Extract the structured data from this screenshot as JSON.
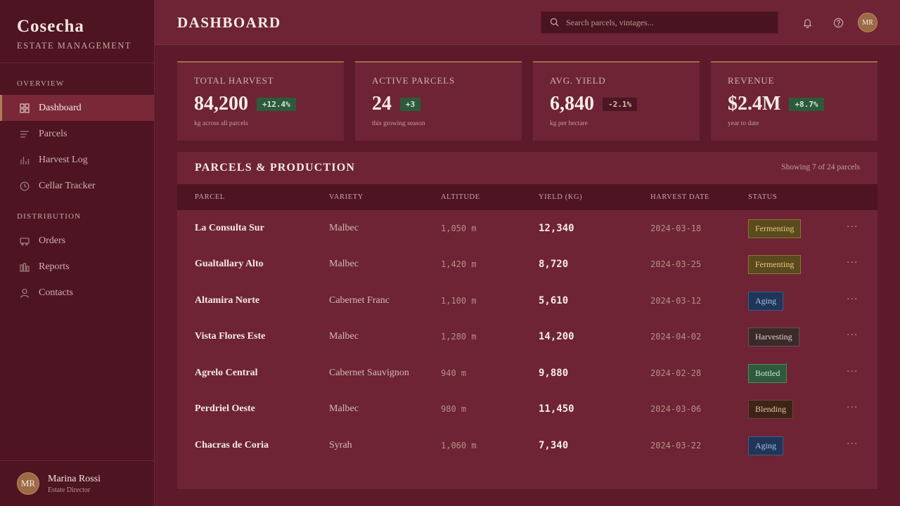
{
  "brand": {
    "name": "Cosecha",
    "subtitle": "ESTATE MANAGEMENT"
  },
  "sidebar": {
    "sections": [
      {
        "label": "OVERVIEW",
        "items": [
          {
            "label": "Dashboard",
            "icon": "grid-icon",
            "active": true
          },
          {
            "label": "Parcels",
            "icon": "list-icon"
          },
          {
            "label": "Harvest Log",
            "icon": "bar-chart-icon"
          },
          {
            "label": "Cellar Tracker",
            "icon": "clock-icon"
          }
        ]
      },
      {
        "label": "DISTRIBUTION",
        "items": [
          {
            "label": "Orders",
            "icon": "truck-icon"
          },
          {
            "label": "Reports",
            "icon": "reports-icon"
          },
          {
            "label": "Contacts",
            "icon": "user-icon"
          }
        ]
      }
    ]
  },
  "user": {
    "name": "Marina Rossi",
    "role": "Estate Director",
    "initials": "MR"
  },
  "header": {
    "title": "DASHBOARD",
    "search_placeholder": "Search parcels, vintages...",
    "avatar_initials": "MR"
  },
  "stats": [
    {
      "label": "TOTAL HARVEST",
      "value": "84,200",
      "change": "+12.4%",
      "trend": "up",
      "foot": "kg across all parcels"
    },
    {
      "label": "ACTIVE PARCELS",
      "value": "24",
      "change": "+3",
      "trend": "up",
      "foot": "this growing season"
    },
    {
      "label": "AVG. YIELD",
      "value": "6,840",
      "change": "-2.1%",
      "trend": "down",
      "foot": "kg per hectare"
    },
    {
      "label": "REVENUE",
      "value": "$2.4M",
      "change": "+8.7%",
      "trend": "up",
      "foot": "year to date"
    }
  ],
  "table": {
    "title": "PARCELS & PRODUCTION",
    "meta": "Showing 7 of 24 parcels",
    "columns": [
      "PARCEL",
      "VARIETY",
      "ALTITUDE",
      "YIELD (KG)",
      "HARVEST DATE",
      "STATUS"
    ],
    "rows": [
      {
        "parcel": "La Consulta Sur",
        "variety": "Malbec",
        "altitude": "1,050 m",
        "yield": "12,340",
        "date": "2024-03-18",
        "status": "Fermenting"
      },
      {
        "parcel": "Gualtallary Alto",
        "variety": "Malbec",
        "altitude": "1,420 m",
        "yield": "8,720",
        "date": "2024-03-25",
        "status": "Fermenting"
      },
      {
        "parcel": "Altamira Norte",
        "variety": "Cabernet Franc",
        "altitude": "1,100 m",
        "yield": "5,610",
        "date": "2024-03-12",
        "status": "Aging"
      },
      {
        "parcel": "Vista Flores Este",
        "variety": "Malbec",
        "altitude": "1,280 m",
        "yield": "14,200",
        "date": "2024-04-02",
        "status": "Harvesting"
      },
      {
        "parcel": "Agrelo Central",
        "variety": "Cabernet Sauvignon",
        "altitude": "940 m",
        "yield": "9,880",
        "date": "2024-02-28",
        "status": "Bottled"
      },
      {
        "parcel": "Perdriel Oeste",
        "variety": "Malbec",
        "altitude": "980 m",
        "yield": "11,450",
        "date": "2024-03-06",
        "status": "Blending"
      },
      {
        "parcel": "Chacras de Coria",
        "variety": "Syrah",
        "altitude": "1,060 m",
        "yield": "7,340",
        "date": "2024-03-22",
        "status": "Aging"
      }
    ],
    "more_label": "···"
  },
  "status_colors": {
    "Fermenting": {
      "bg": "#5a4a1e",
      "fg": "#e8c97a",
      "border": "#8c7430"
    },
    "Aging": {
      "bg": "#1f3658",
      "fg": "#a8c2e6",
      "border": "#3b5a86"
    },
    "Harvesting": {
      "bg": "#3a2a2a",
      "fg": "#e0cfc8",
      "border": "#6b5050"
    },
    "Bottled": {
      "bg": "#2e5a3c",
      "fg": "#cfe8d2",
      "border": "#4d8a5e"
    },
    "Blending": {
      "bg": "#3e2418",
      "fg": "#e8c49a",
      "border": "#6b4430"
    }
  }
}
